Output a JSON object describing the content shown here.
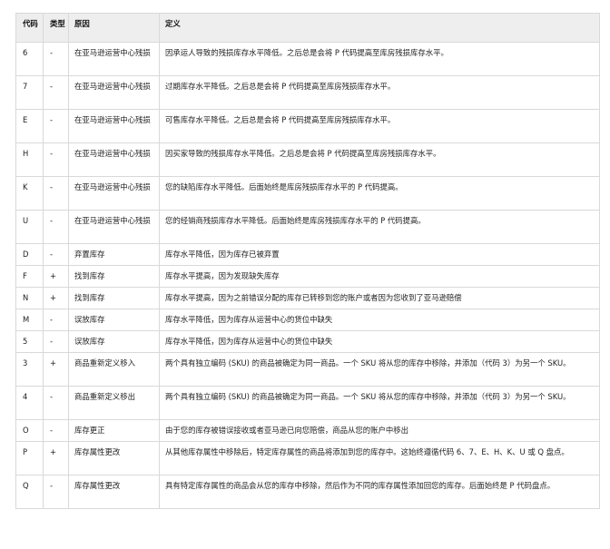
{
  "table": {
    "headers": {
      "code": "代码",
      "type": "类型",
      "reason": "原因",
      "definition": "定义"
    },
    "rows": [
      {
        "code": "6",
        "type": "-",
        "reason": "在亚马逊运营中心残损",
        "definition": "因承运人导致的残损库存水平降低。之后总是会将 P 代码提高至库房残损库存水平。"
      },
      {
        "code": "7",
        "type": "-",
        "reason": "在亚马逊运营中心残损",
        "definition": "过期库存水平降低。之后总是会将 P 代码提高至库房残损库存水平。"
      },
      {
        "code": "E",
        "type": "-",
        "reason": "在亚马逊运营中心残损",
        "definition": "可售库存水平降低。之后总是会将 P 代码提高至库房残损库存水平。"
      },
      {
        "code": "H",
        "type": "-",
        "reason": "在亚马逊运营中心残损",
        "definition": "因买家导致的残损库存水平降低。之后总是会将 P 代码提高至库房残损库存水平。"
      },
      {
        "code": "K",
        "type": "-",
        "reason": "在亚马逊运营中心残损",
        "definition": "您的缺陷库存水平降低。后面始终是库房残损库存水平的 P 代码提高。"
      },
      {
        "code": "U",
        "type": "-",
        "reason": "在亚马逊运营中心残损",
        "definition": "您的经销商残损库存水平降低。后面始终是库房残损库存水平的 P 代码提高。"
      },
      {
        "code": "D",
        "type": "-",
        "reason": "弃置库存",
        "definition": "库存水平降低，因为库存已被弃置"
      },
      {
        "code": "F",
        "type": "+",
        "reason": "找到库存",
        "definition": "库存水平提高，因为发现缺失库存"
      },
      {
        "code": "N",
        "type": "+",
        "reason": "找到库存",
        "definition": "库存水平提高，因为之前错误分配的库存已转移到您的账户或者因为您收到了亚马逊赔偿"
      },
      {
        "code": "M",
        "type": "-",
        "reason": "误放库存",
        "definition": "库存水平降低，因为库存从运营中心的货位中缺失"
      },
      {
        "code": "5",
        "type": "-",
        "reason": "误放库存",
        "definition": "库存水平降低，因为库存从运营中心的货位中缺失"
      },
      {
        "code": "3",
        "type": "+",
        "reason": "商品重新定义移入",
        "definition": "两个具有独立编码 (SKU) 的商品被确定为同一商品。一个 SKU 将从您的库存中移除，并添加（代码 3）为另一个 SKU。"
      },
      {
        "code": "4",
        "type": "-",
        "reason": "商品重新定义移出",
        "definition": "两个具有独立编码 (SKU) 的商品被确定为同一商品。一个 SKU 将从您的库存中移除，并添加（代码 3）为另一个 SKU。"
      },
      {
        "code": "O",
        "type": "-",
        "reason": "库存更正",
        "definition": "由于您的库存被错误接收或者亚马逊已向您赔偿，商品从您的账户中移出"
      },
      {
        "code": "P",
        "type": "+",
        "reason": "库存属性更改",
        "definition": "从其他库存属性中移除后，特定库存属性的商品将添加到您的库存中。这始终遵循代码 6、7、E、H、K、U 或 Q 盘点。"
      },
      {
        "code": "Q",
        "type": "-",
        "reason": "库存属性更改",
        "definition": "具有特定库存属性的商品会从您的库存中移除，然后作为不同的库存属性添加回您的库存。后面始终是 P 代码盘点。"
      }
    ]
  }
}
